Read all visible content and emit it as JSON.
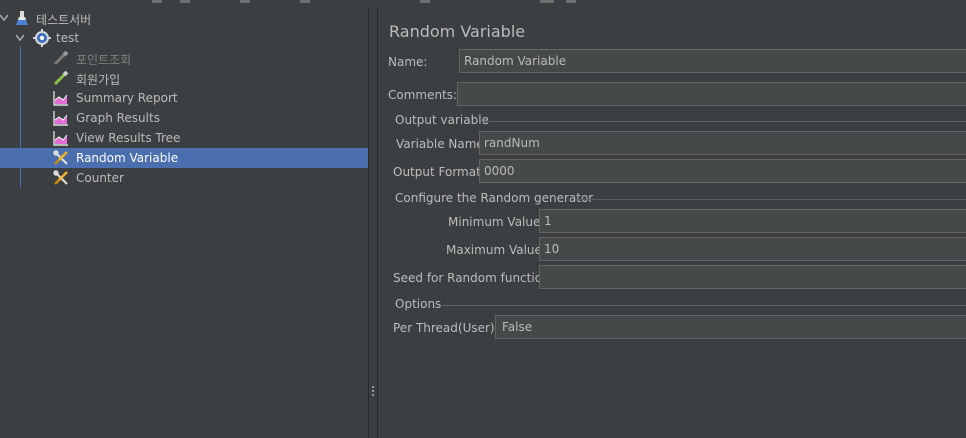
{
  "tree": {
    "items": [
      {
        "label": "테스트서버",
        "icon": "flask-icon",
        "state": "normal"
      },
      {
        "label": "test",
        "icon": "gear-icon",
        "state": "normal"
      },
      {
        "label": "포인트조회",
        "icon": "pipette-icon",
        "state": "disabled"
      },
      {
        "label": "회원가입",
        "icon": "pipette-icon",
        "state": "normal"
      },
      {
        "label": "Summary Report",
        "icon": "chart-icon",
        "state": "normal"
      },
      {
        "label": "Graph Results",
        "icon": "chart-icon",
        "state": "normal"
      },
      {
        "label": "View Results Tree",
        "icon": "chart-icon",
        "state": "normal"
      },
      {
        "label": "Random Variable",
        "icon": "tools-icon",
        "state": "selected"
      },
      {
        "label": "Counter",
        "icon": "tools-icon",
        "state": "normal"
      }
    ]
  },
  "form": {
    "title": "Random Variable",
    "name_label": "Name:",
    "name_value": "Random Variable",
    "comments_label": "Comments:",
    "comments_value": "",
    "output_section": "Output variable",
    "variable_name_label": "Variable Name:",
    "variable_name_value": "randNum",
    "output_format_label": "Output Format:",
    "output_format_value": "0000",
    "generator_section": "Configure the Random generator",
    "min_label": "Minimum Value:",
    "min_value": "1",
    "max_label": "Maximum Value:",
    "max_value": "10",
    "seed_label": "Seed for Random function:",
    "seed_value": "",
    "options_section": "Options",
    "per_thread_label": "Per Thread(User) ?:",
    "per_thread_value": "False"
  },
  "colors": {
    "background": "#3c3f41",
    "selection": "#4b6eaf",
    "field": "#45494a",
    "text": "#bbbbbb"
  }
}
